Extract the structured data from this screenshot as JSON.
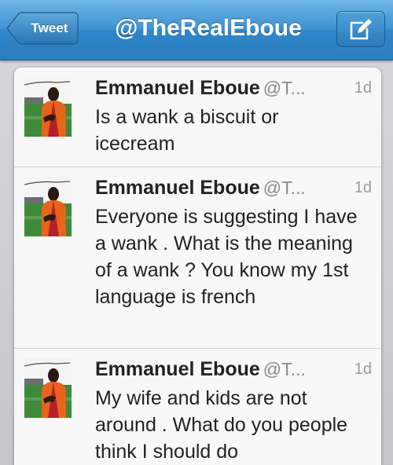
{
  "navbar": {
    "back_label": "Tweet",
    "title": "@TheRealEboue",
    "compose_icon": "compose-icon"
  },
  "tweets": [
    {
      "name": "Emmanuel Eboue",
      "handle": "@T...",
      "time": "1d",
      "text": "Is a wank a biscuit or icecream"
    },
    {
      "name": "Emmanuel Eboue",
      "handle": "@T...",
      "time": "1d",
      "text": "Everyone is suggesting I have a wank . What is the meaning of a wank ? You know my 1st language is french"
    },
    {
      "name": "Emmanuel Eboue",
      "handle": "@T...",
      "time": "1d",
      "text": "My wife and kids are not around . What do you people think I should do"
    }
  ],
  "colors": {
    "navbar": "#3d93d1",
    "jersey_orange": "#e8641c",
    "jersey_red": "#b3202a"
  }
}
